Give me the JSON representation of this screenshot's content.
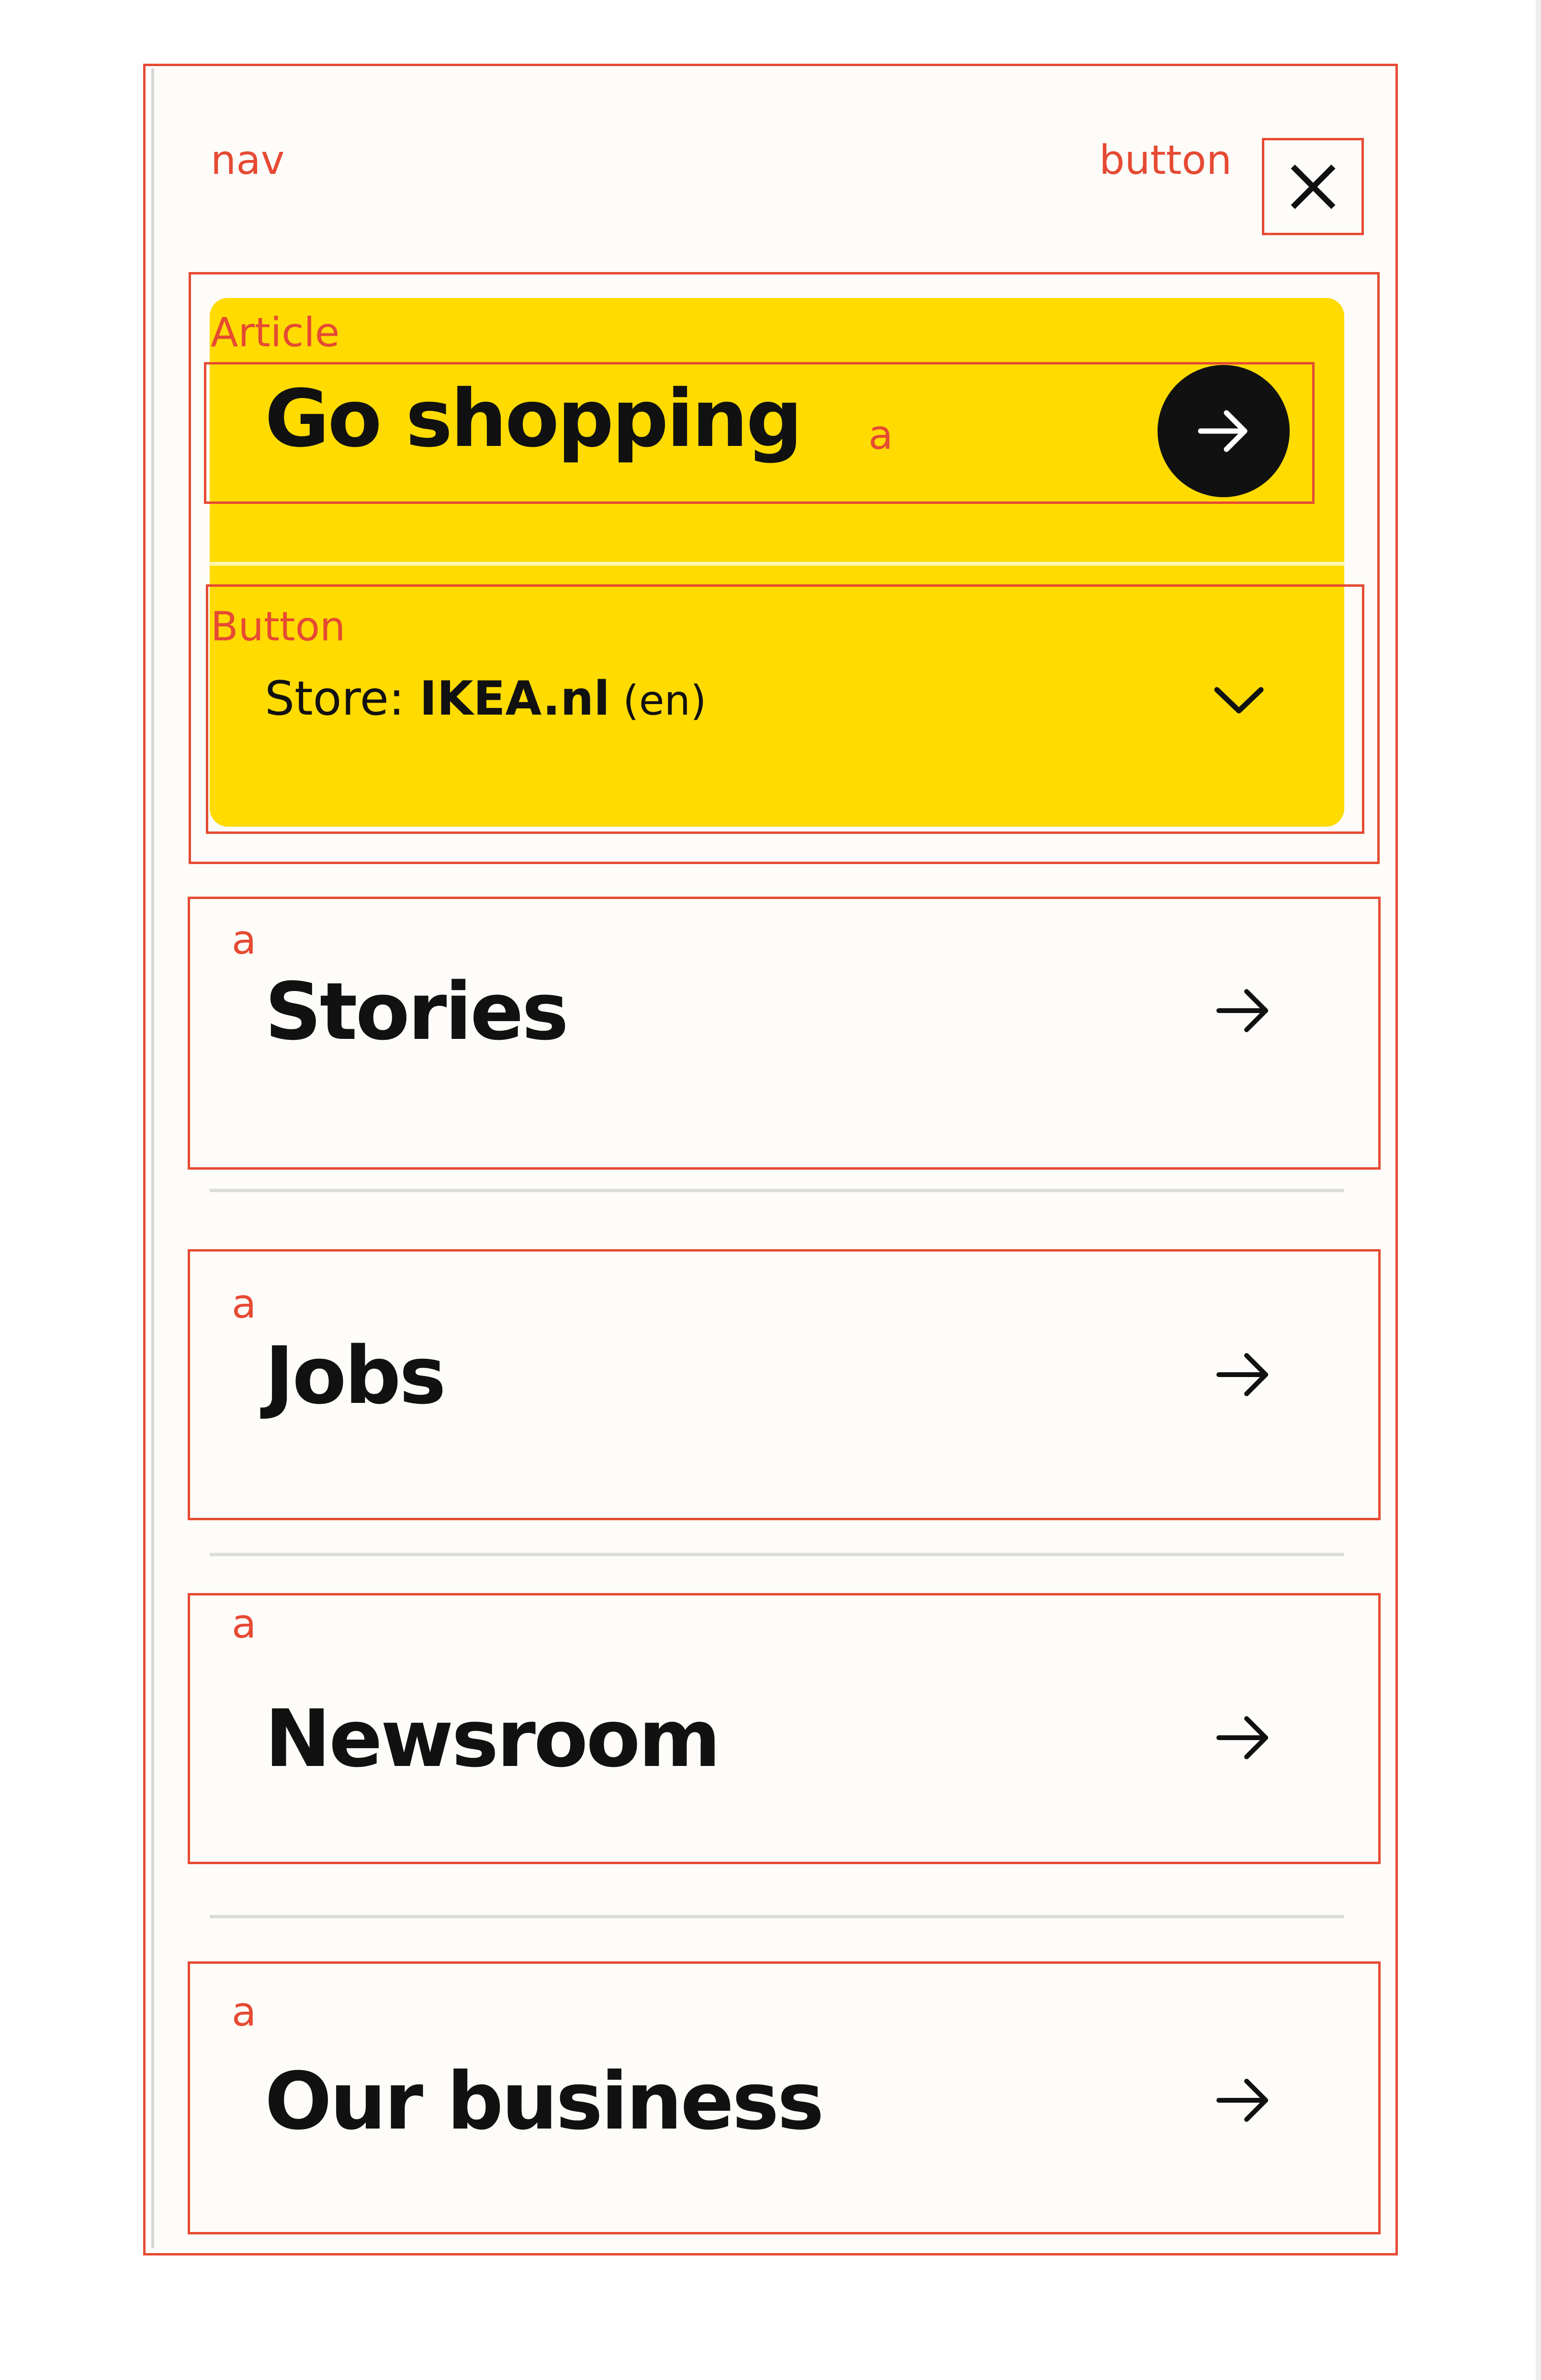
{
  "nav": {
    "close_button": {
      "icon": "close-icon"
    },
    "shop_card": {
      "title": "Go shopping",
      "arrow_icon": "arrow-right-icon",
      "store_prefix": "Store: ",
      "store_name": "IKEA.nl",
      "store_lang": " (en)",
      "chevron_icon": "chevron-down-icon",
      "color": "#FFDB00"
    },
    "links": [
      {
        "label": "Stories",
        "icon": "arrow-right-icon"
      },
      {
        "label": "Jobs",
        "icon": "arrow-right-icon"
      },
      {
        "label": "Newsroom",
        "icon": "arrow-right-icon"
      },
      {
        "label": "Our business",
        "icon": "arrow-right-icon"
      }
    ]
  },
  "annotations": {
    "nav": "nav",
    "button": "button",
    "article": "Article",
    "a_go": "a",
    "store_button": "Button",
    "a_stories": "a",
    "a_jobs": "a",
    "a_newsroom": "a",
    "a_business": "a"
  },
  "colors": {
    "panel_bg": "#FDFCF9",
    "accent_yellow": "#FFDB00",
    "text": "#111111",
    "annotation": "#E64A33"
  }
}
